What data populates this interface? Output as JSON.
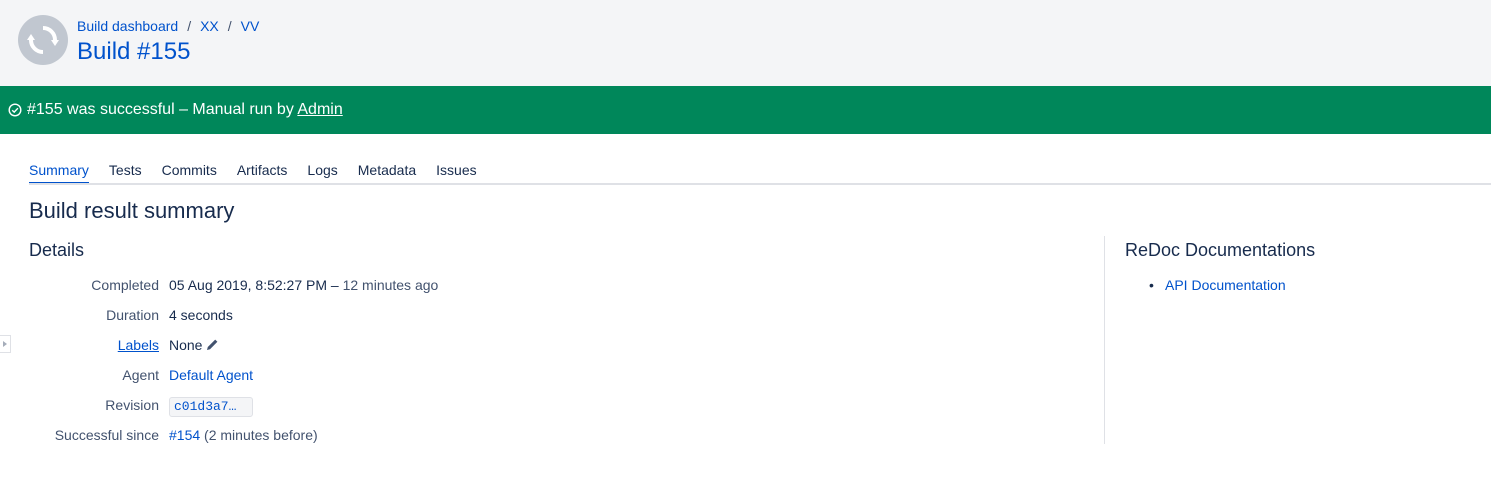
{
  "header": {
    "breadcrumbs": [
      "Build dashboard",
      "XX",
      "VV"
    ],
    "breadcrumb_separator": "/",
    "title": "Build #155",
    "avatar_icon": "refresh-icon"
  },
  "status": {
    "icon": "check-circle-icon",
    "prefix": "#155 was successful – Manual run by ",
    "user": "Admin",
    "color": "#00875a"
  },
  "tabs": [
    "Summary",
    "Tests",
    "Commits",
    "Artifacts",
    "Logs",
    "Metadata",
    "Issues"
  ],
  "active_tab": "Summary",
  "main": {
    "heading": "Build result summary",
    "details_heading": "Details",
    "details": {
      "completed_label": "Completed",
      "completed_value": "05 Aug 2019, 8:52:27 PM – ",
      "completed_relative": "12 minutes ago",
      "duration_label": "Duration",
      "duration_value": "4 seconds",
      "labels_label": "Labels",
      "labels_value": "None",
      "agent_label": "Agent",
      "agent_value": "Default Agent",
      "revision_label": "Revision",
      "revision_value": "c01d3a7…",
      "since_label": "Successful since",
      "since_build": "#154",
      "since_note": " (2 minutes before)"
    }
  },
  "sidebar": {
    "heading": "ReDoc Documentations",
    "links": [
      "API Documentation"
    ]
  },
  "colors": {
    "link": "#0052cc",
    "text": "#172b4d",
    "header_bg": "#f4f5f7"
  }
}
